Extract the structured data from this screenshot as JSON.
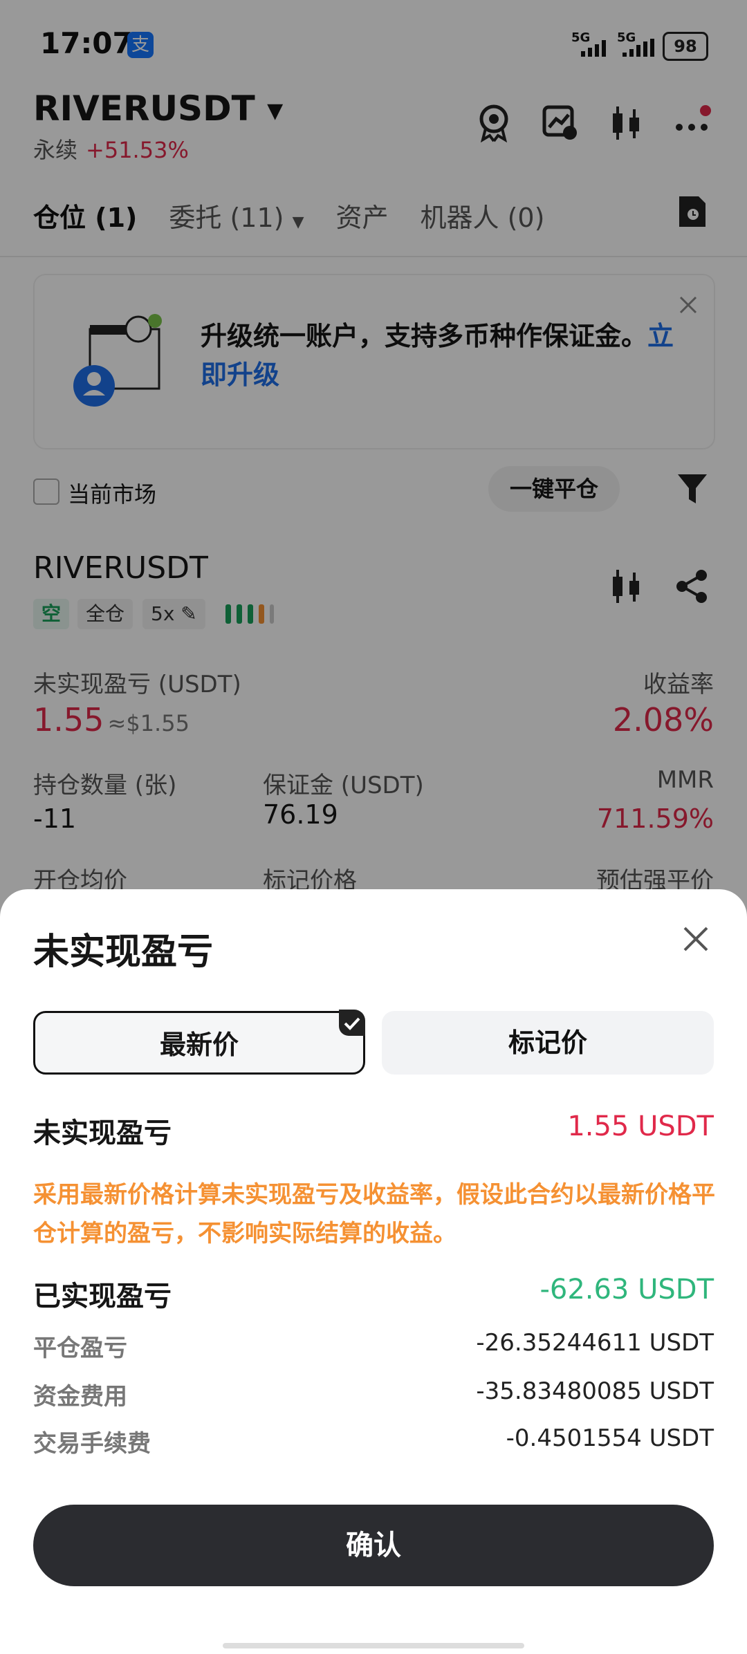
{
  "status_bar": {
    "time": "17:07",
    "alipay_badge": "支",
    "signal_1": "5G",
    "signal_2": "5G",
    "battery": "98"
  },
  "header": {
    "symbol": "RIVERUSDT",
    "contract_type": "永续",
    "change": "+51.53%"
  },
  "tabs": [
    {
      "label": "仓位 (1)"
    },
    {
      "label": "委托 (11)"
    },
    {
      "label": "资产"
    },
    {
      "label": "机器人 (0)"
    }
  ],
  "banner": {
    "text": "升级统一账户，支持多币种作保证金。",
    "link": "立即升级"
  },
  "filter": {
    "current_market": "当前市场",
    "close_all": "一键平仓"
  },
  "position": {
    "symbol": "RIVERUSDT",
    "tags": {
      "side": "空",
      "mode": "全仓",
      "leverage": "5x"
    },
    "unrealized_label": "未实现盈亏 (USDT)",
    "unrealized_value": "1.55",
    "unrealized_usd": "≈$1.55",
    "roi_label": "收益率",
    "roi_value": "2.08%",
    "qty_label": "持仓数量 (张)",
    "qty_value": "-11",
    "margin_label": "保证金 (USDT)",
    "margin_value": "76.19",
    "mmr_label": "MMR",
    "mmr_value": "711.59%",
    "entry_label": "开仓均价",
    "mark_label": "标记价格",
    "liq_label": "预估强平价"
  },
  "sheet": {
    "title": "未实现盈亏",
    "seg_latest": "最新价",
    "seg_mark": "标记价",
    "unrealized_title": "未实现盈亏",
    "unrealized_value": "1.55 USDT",
    "note": "采用最新价格计算未实现盈亏及收益率，假设此合约以最新价格平仓计算的盈亏，不影响实际结算的收益。",
    "realized_title": "已实现盈亏",
    "realized_value": "-62.63 USDT",
    "rows": [
      {
        "label": "平仓盈亏",
        "value": "-26.35244611 USDT"
      },
      {
        "label": "资金费用",
        "value": "-35.83480085 USDT"
      },
      {
        "label": "交易手续费",
        "value": "-0.4501554 USDT"
      }
    ],
    "confirm": "确认"
  },
  "colors": {
    "red": "#e0294a",
    "green": "#2fb67c",
    "orange": "#f59133",
    "link": "#1e6ee8",
    "dark": "#2b2c30"
  }
}
